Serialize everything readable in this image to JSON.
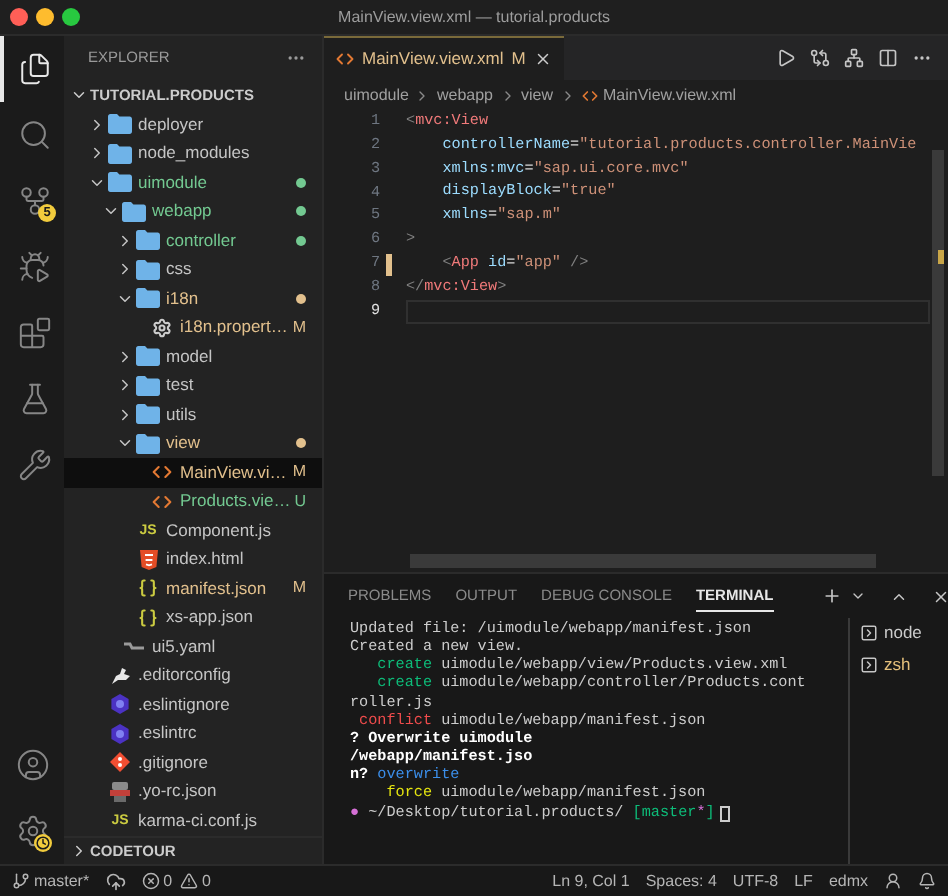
{
  "window": {
    "title": "MainView.view.xml — tutorial.products"
  },
  "activity_bar": {
    "items": [
      {
        "kind": "files",
        "selected": true
      },
      {
        "kind": "search",
        "selected": false
      },
      {
        "kind": "source-control",
        "selected": false,
        "badge": "5"
      },
      {
        "kind": "run-debug",
        "selected": false
      },
      {
        "kind": "extensions",
        "selected": false
      },
      {
        "kind": "testing",
        "selected": false
      },
      {
        "kind": "tools",
        "selected": false
      }
    ],
    "bottom_items": [
      {
        "kind": "account"
      },
      {
        "kind": "settings"
      }
    ]
  },
  "sidebar": {
    "title": "EXPLORER",
    "section": {
      "title": "TUTORIAL.PRODUCTS",
      "expanded": true,
      "tree": [
        {
          "name": "deployer",
          "kind": "folder",
          "expanded": false,
          "color": "#c5c5c5",
          "dot": false,
          "selected": false
        },
        {
          "name": "node_modules",
          "kind": "folder",
          "expanded": false,
          "color": "#c5c5c5",
          "dot": false,
          "selected": false
        },
        {
          "name": "uimodule",
          "kind": "folder",
          "expanded": true,
          "color": "#73c991",
          "dot": true,
          "selected": false,
          "children": [
            {
              "name": "webapp",
              "kind": "folder",
              "expanded": true,
              "color": "#73c991",
              "dot": true,
              "selected": false,
              "children": [
                {
                  "name": "controller",
                  "kind": "folder",
                  "expanded": false,
                  "color": "#73c991",
                  "dot": true,
                  "selected": false
                },
                {
                  "name": "css",
                  "kind": "folder",
                  "expanded": false,
                  "color": "#c5c5c5",
                  "dot": false,
                  "selected": false
                },
                {
                  "name": "i18n",
                  "kind": "folder",
                  "expanded": true,
                  "color": "#e2c08d",
                  "dot": true,
                  "selected": false,
                  "children": [
                    {
                      "name": "i18n.propert…",
                      "kind": "settings",
                      "color": "#e2c08d",
                      "badge": "M",
                      "selected": false
                    }
                  ]
                },
                {
                  "name": "model",
                  "kind": "folder",
                  "expanded": false,
                  "color": "#c5c5c5",
                  "dot": false,
                  "selected": false
                },
                {
                  "name": "test",
                  "kind": "folder",
                  "expanded": false,
                  "color": "#c5c5c5",
                  "dot": false,
                  "selected": false
                },
                {
                  "name": "utils",
                  "kind": "folder",
                  "expanded": false,
                  "color": "#c5c5c5",
                  "dot": false,
                  "selected": false
                },
                {
                  "name": "view",
                  "kind": "folder",
                  "expanded": true,
                  "color": "#e2c08d",
                  "dot": true,
                  "selected": false,
                  "children": [
                    {
                      "name": "MainView.vi…",
                      "kind": "xml",
                      "color": "#e2c08d",
                      "badge": "M",
                      "selected": true
                    },
                    {
                      "name": "Products.vie…",
                      "kind": "xml",
                      "color": "#73c991",
                      "badge": "U",
                      "selected": false
                    }
                  ]
                },
                {
                  "name": "Component.js",
                  "kind": "js",
                  "icon_label": "JS",
                  "color": "#c5c5c5",
                  "selected": false
                },
                {
                  "name": "index.html",
                  "kind": "html",
                  "color": "#c5c5c5",
                  "selected": false
                },
                {
                  "name": "manifest.json",
                  "kind": "json",
                  "color": "#e2c08d",
                  "badge": "M",
                  "selected": false
                },
                {
                  "name": "xs-app.json",
                  "kind": "json",
                  "color": "#c5c5c5",
                  "selected": false
                }
              ]
            },
            {
              "name": "ui5.yaml",
              "kind": "yaml",
              "color": "#c5c5c5",
              "selected": false
            }
          ]
        },
        {
          "name": ".editorconfig",
          "kind": "editorconfig",
          "color": "#c5c5c5",
          "selected": false
        },
        {
          "name": ".eslintignore",
          "kind": "eslint",
          "color": "#c5c5c5",
          "selected": false
        },
        {
          "name": ".eslintrc",
          "kind": "eslint",
          "color": "#c5c5c5",
          "selected": false
        },
        {
          "name": ".gitignore",
          "kind": "git",
          "color": "#c5c5c5",
          "selected": false
        },
        {
          "name": ".yo-rc.json",
          "kind": "yo",
          "color": "#c5c5c5",
          "selected": false
        },
        {
          "name": "karma-ci.conf.js",
          "kind": "js",
          "icon_label": "JS",
          "color": "#c5c5c5",
          "selected": false
        }
      ]
    },
    "collapsed_section": {
      "title": "CODETOUR",
      "expanded": false
    }
  },
  "editor": {
    "tabs": [
      {
        "label": "MainView.view.xml",
        "badge": "M",
        "color": "#e2c08d",
        "selected": true
      }
    ],
    "breadcrumb": [
      "uimodule",
      "webapp",
      "view",
      "MainView.view.xml"
    ],
    "lines": [
      {
        "number": "1",
        "modified": false,
        "current": false,
        "tokens": [
          {
            "text": "<",
            "kind": "punct"
          },
          {
            "text": "mvc:View",
            "kind": "tag"
          }
        ]
      },
      {
        "number": "2",
        "modified": false,
        "current": false,
        "tokens": [
          {
            "text": "    controllerName",
            "kind": "attr"
          },
          {
            "text": "=",
            "kind": "eq"
          },
          {
            "text": "\"tutorial.products.controller.MainVie",
            "kind": "string"
          }
        ]
      },
      {
        "number": "3",
        "modified": false,
        "current": false,
        "tokens": [
          {
            "text": "    xmlns:mvc",
            "kind": "attr"
          },
          {
            "text": "=",
            "kind": "eq"
          },
          {
            "text": "\"sap.ui.core.mvc\"",
            "kind": "string"
          }
        ]
      },
      {
        "number": "4",
        "modified": false,
        "current": false,
        "tokens": [
          {
            "text": "    displayBlock",
            "kind": "attr"
          },
          {
            "text": "=",
            "kind": "eq"
          },
          {
            "text": "\"true\"",
            "kind": "string"
          }
        ]
      },
      {
        "number": "5",
        "modified": false,
        "current": false,
        "tokens": [
          {
            "text": "    xmlns",
            "kind": "attr"
          },
          {
            "text": "=",
            "kind": "eq"
          },
          {
            "text": "\"sap.m\"",
            "kind": "string"
          }
        ]
      },
      {
        "number": "6",
        "modified": false,
        "current": false,
        "tokens": [
          {
            "text": ">",
            "kind": "punct"
          }
        ]
      },
      {
        "number": "7",
        "modified": true,
        "current": false,
        "tokens": [
          {
            "text": "    <",
            "kind": "punct"
          },
          {
            "text": "App",
            "kind": "tag"
          },
          {
            "text": " id",
            "kind": "attr"
          },
          {
            "text": "=",
            "kind": "eq"
          },
          {
            "text": "\"app\"",
            "kind": "string"
          },
          {
            "text": " />",
            "kind": "punct"
          }
        ]
      },
      {
        "number": "8",
        "modified": false,
        "current": false,
        "tokens": [
          {
            "text": "</",
            "kind": "punct"
          },
          {
            "text": "mvc:View",
            "kind": "tag"
          },
          {
            "text": ">",
            "kind": "punct"
          }
        ]
      },
      {
        "number": "9",
        "modified": false,
        "current": true
      }
    ]
  },
  "panel": {
    "tabs": [
      {
        "label": "PROBLEMS",
        "selected": false
      },
      {
        "label": "OUTPUT",
        "selected": false
      },
      {
        "label": "DEBUG CONSOLE",
        "selected": false
      },
      {
        "label": "TERMINAL",
        "selected": true
      }
    ],
    "terminal_lines": [
      {
        "cursor": false,
        "segments": [
          {
            "text": "Updated file: /uimodule/webapp/manifest.json",
            "kind": "plain"
          }
        ]
      },
      {
        "cursor": false,
        "segments": [
          {
            "text": "Created a new view.",
            "kind": "plain"
          }
        ]
      },
      {
        "cursor": false,
        "segments": [
          {
            "text": "   create",
            "kind": "green"
          },
          {
            "text": " uimodule/webapp/view/Products.view.xml",
            "kind": "plain"
          }
        ]
      },
      {
        "cursor": false,
        "segments": [
          {
            "text": "   create",
            "kind": "green"
          },
          {
            "text": " uimodule/webapp/controller/Products.cont",
            "kind": "plain"
          }
        ]
      },
      {
        "cursor": false,
        "segments": [
          {
            "text": "roller.js",
            "kind": "plain"
          }
        ]
      },
      {
        "cursor": false,
        "segments": [
          {
            "text": " conflict",
            "kind": "red"
          },
          {
            "text": " uimodule/webapp/manifest.json",
            "kind": "plain"
          }
        ]
      },
      {
        "cursor": false,
        "segments": [
          {
            "text": "? Overwrite uimodule",
            "kind": "bold"
          }
        ]
      },
      {
        "cursor": false,
        "segments": [
          {
            "text": "/webapp/manifest.jso",
            "kind": "bold"
          }
        ]
      },
      {
        "cursor": false,
        "segments": [
          {
            "text": "n? ",
            "kind": "bold"
          },
          {
            "text": "overwrite",
            "kind": "blue"
          }
        ]
      },
      {
        "cursor": false,
        "segments": [
          {
            "text": "    force",
            "kind": "yellow"
          },
          {
            "text": " uimodule/webapp/manifest.json",
            "kind": "plain"
          }
        ]
      },
      {
        "cursor": true,
        "segments": [
          {
            "text": "● ",
            "kind": "magenta"
          },
          {
            "text": "~/Desktop/tutorial.products/ ",
            "kind": "plain"
          },
          {
            "text": "[master",
            "kind": "green"
          },
          {
            "text": "*",
            "kind": "magenta"
          },
          {
            "text": "]",
            "kind": "green"
          }
        ]
      }
    ],
    "terminals": [
      {
        "name": "node",
        "color": "#cccccc"
      },
      {
        "name": "zsh",
        "color": "#e5c07b"
      }
    ]
  },
  "status_bar": {
    "branch": "master*",
    "errors": "0",
    "warnings": "0",
    "items": [
      "Ln 9, Col 1",
      "Spaces: 4",
      "UTF-8",
      "LF",
      "edmx"
    ]
  }
}
